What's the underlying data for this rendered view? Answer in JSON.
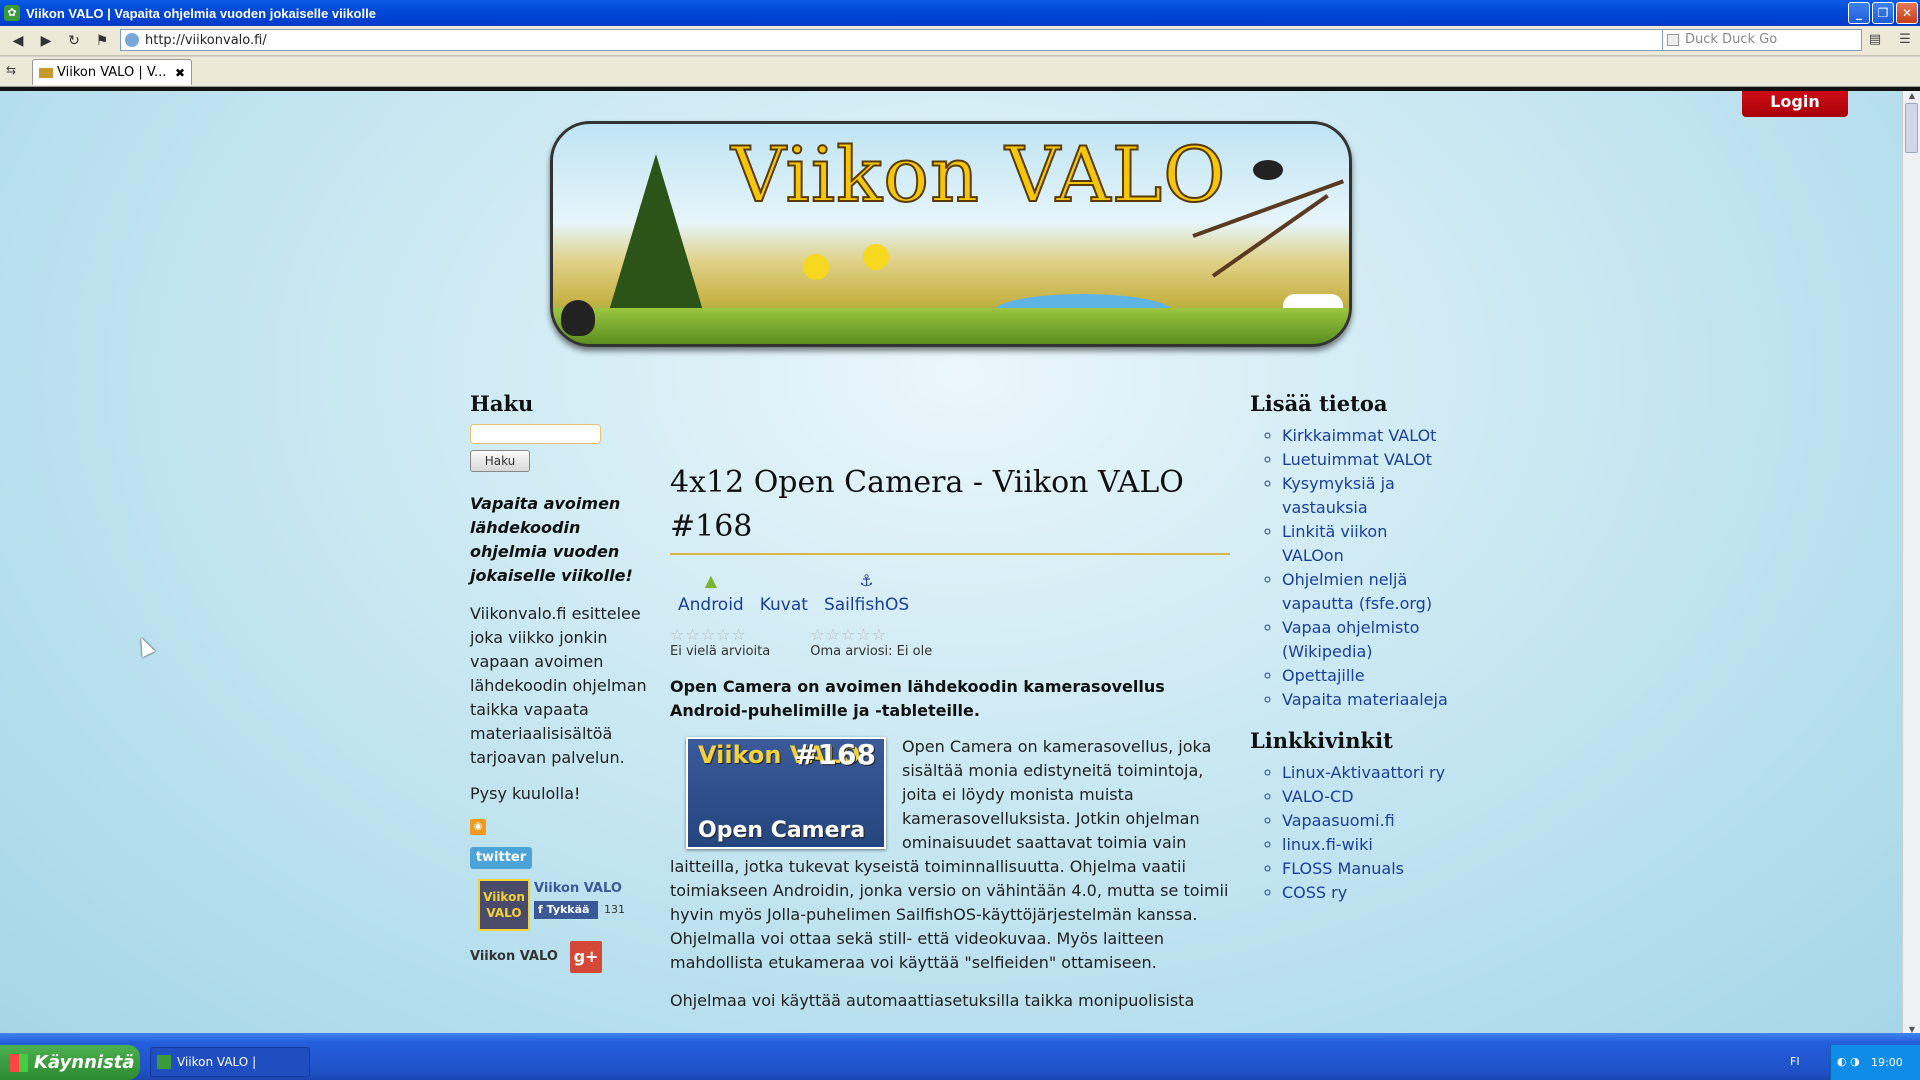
{
  "window": {
    "title": "Viikon VALO | Vapaita ohjelmia vuoden jokaiselle viikolle",
    "buttons": [
      "minimize",
      "restore",
      "close"
    ]
  },
  "navbar": {
    "back_icon": "back-arrow-icon",
    "forward_icon": "forward-arrow-icon",
    "reload_icon": "reload-icon",
    "url": "http://viikonvalo.fi/",
    "search_placeholder": "Duck Duck Go"
  },
  "tab": {
    "label": "Viikon VALO | V...",
    "close": "✖"
  },
  "page": {
    "login_label": "Login",
    "banner_title": "Viikon VALO",
    "left": {
      "search_title": "Haku",
      "search_button": "Haku",
      "tagline": "Vapaita avoimen lähdekoodin ohjelmia vuoden jokaiselle viikolle!",
      "description": "Viikonvalo.fi esittelee joka viikko jonkin vapaan avoimen lähdekoodin ohjelman taikka vapaata materiaalisisältöä tarjoavan palvelun.",
      "stay": "Pysy kuulolla!",
      "twitter": "twitter",
      "fb_logo_line1": "Viikon",
      "fb_logo_line2": "VALO",
      "fb_name": "Viikon VALO",
      "fb_like": "Tykkää",
      "fb_count": "131",
      "gplus_label": "Viikon VALO",
      "gplus_glyph": "g+"
    },
    "main": {
      "title": "4x12 Open Camera - Viikon VALO #168",
      "platforms": [
        "Android",
        "Kuvat",
        "SailfishOS"
      ],
      "rating_none": "Ei vielä arvioita",
      "rating_own": "Oma arviosi: Ei ole",
      "lead": "Open Camera on avoimen lähdekoodin kamerasovellus Android-puhelimille ja -tableteille.",
      "image_line1": "Viikon VALO",
      "image_number": "#168",
      "image_name": "Open Camera",
      "body": "Open Camera on kamerasovellus, joka sisältää monia edistyneitä toimintoja, joita ei löydy monista muista kamerasovelluksista. Jotkin ohjelman ominaisuudet saattavat toimia vain laitteilla, jotka tukevat kyseistä toiminnallisuutta. Ohjelma vaatii toimiakseen Androidin, jonka versio on vähintään 4.0, mutta se toimii hyvin myös Jolla-puhelimen SailfishOS-käyttöjärjestelmän kanssa. Ohjelmalla voi ottaa sekä still- että videokuvaa. Myös laitteen mahdollista etukameraa voi käyttää \"selfieiden\" ottamiseen.",
      "para2": "Ohjelmaa voi käyttää automaattiasetuksilla taikka monipuolisista"
    },
    "right": {
      "info_title": "Lisää tietoa",
      "info_links": [
        "Kirkkaimmat VALOt",
        "Luetuimmat VALOt",
        "Kysymyksiä ja vastauksia",
        "Linkitä viikon VALOon",
        "Ohjelmien neljä vapautta (fsfe.org)",
        "Vapaa ohjelmisto (Wikipedia)",
        "Opettajille",
        "Vapaita materiaaleja"
      ],
      "links_title": "Linkkivinkit",
      "tip_links": [
        "Linux-Aktivaattori ry",
        "VALO-CD",
        "Vapaasuomi.fi",
        "linux.fi-wiki",
        "FLOSS Manuals",
        "COSS ry"
      ]
    }
  },
  "taskbar": {
    "start": "Käynnistä",
    "task": "Viikon VALO | Vapaita...",
    "lang": "FI",
    "time": "19:00"
  },
  "colors": {
    "titlebar": "#0048d8",
    "login": "#c8000f",
    "link": "#1a3f9a",
    "accent_rule": "#d9b54a"
  }
}
